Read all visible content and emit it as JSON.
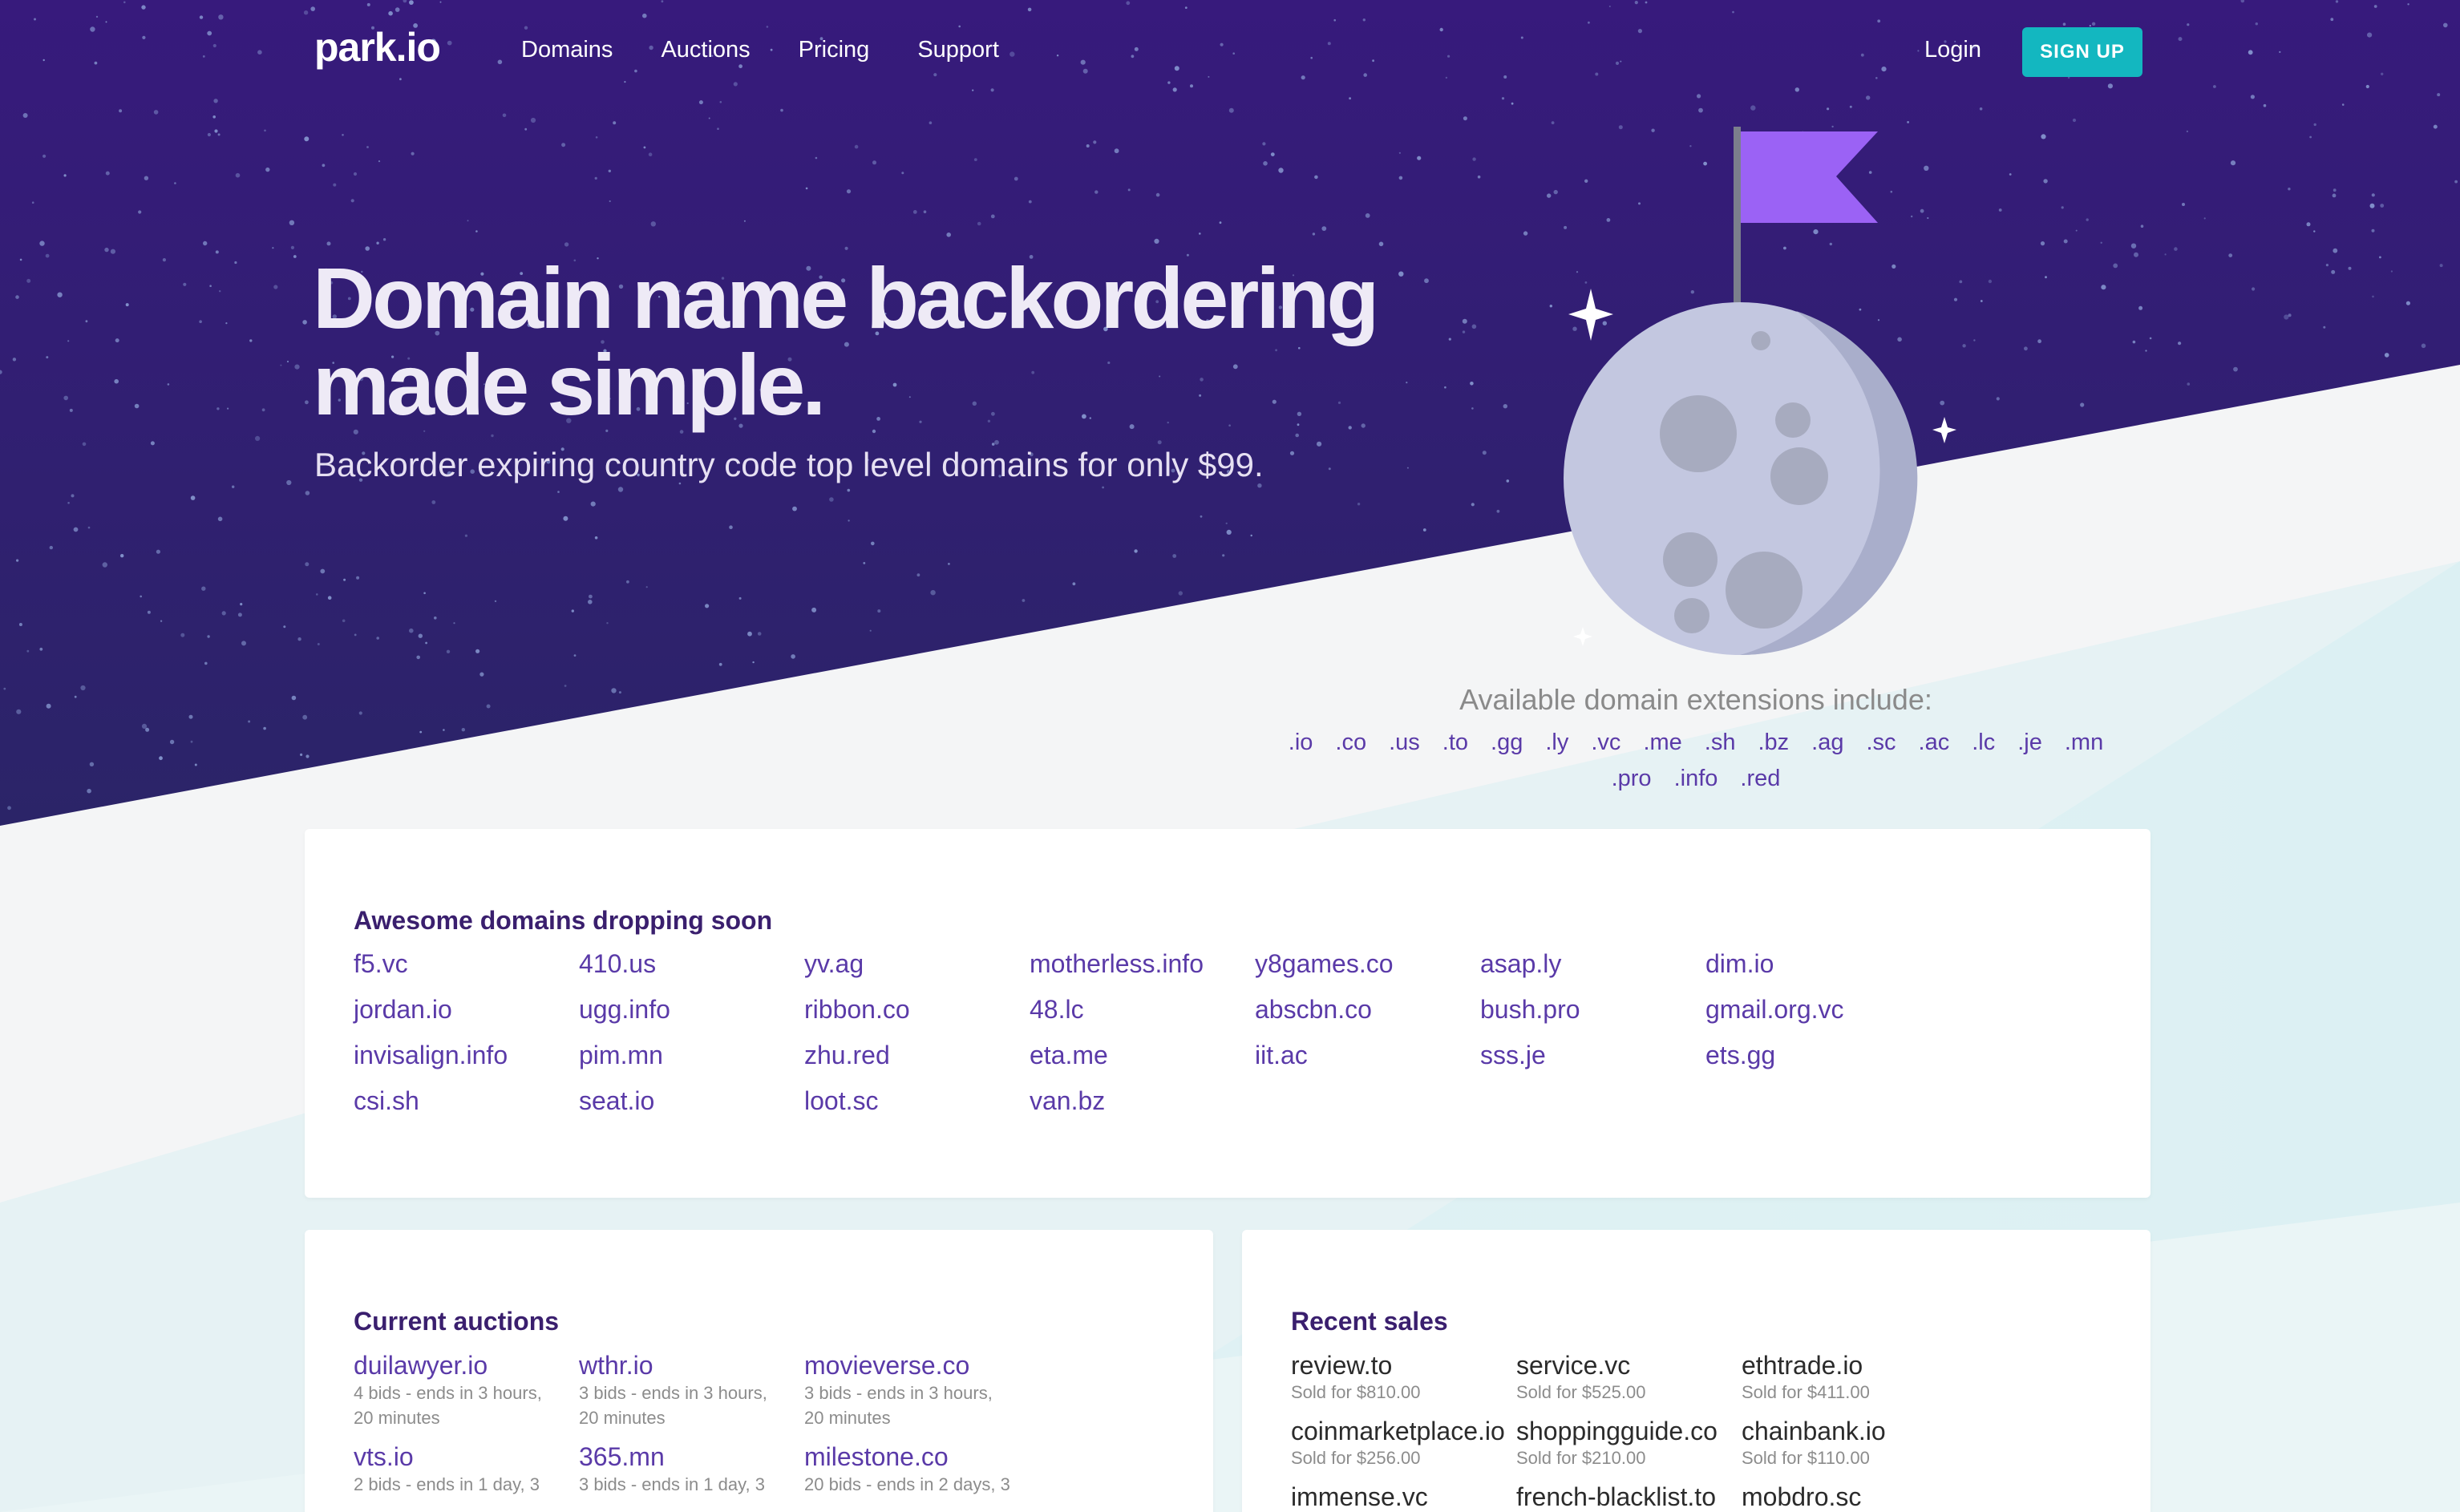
{
  "nav": {
    "logo": "park.io",
    "links": [
      "Domains",
      "Auctions",
      "Pricing",
      "Support"
    ],
    "login": "Login",
    "signup": "SIGN UP"
  },
  "hero": {
    "title_line1": "Domain name backordering",
    "title_line2": "made simple.",
    "subtitle": "Backorder expiring country code top level domains for only $99."
  },
  "extensions": {
    "title": "Available domain extensions include:",
    "items": [
      ".io",
      ".co",
      ".us",
      ".to",
      ".gg",
      ".ly",
      ".vc",
      ".me",
      ".sh",
      ".bz",
      ".ag",
      ".sc",
      ".ac",
      ".lc",
      ".je",
      ".mn",
      ".pro",
      ".info",
      ".red"
    ]
  },
  "dropping": {
    "title": "Awesome domains dropping soon",
    "domains": [
      "f5.vc",
      "410.us",
      "yv.ag",
      "motherless.info",
      "y8games.co",
      "asap.ly",
      "dim.io",
      "jordan.io",
      "ugg.info",
      "ribbon.co",
      "48.lc",
      "abscbn.co",
      "bush.pro",
      "gmail.org.vc",
      "invisalign.info",
      "pim.mn",
      "zhu.red",
      "eta.me",
      "iit.ac",
      "sss.je",
      "ets.gg",
      "csi.sh",
      "seat.io",
      "loot.sc",
      "van.bz"
    ]
  },
  "auctions": {
    "title": "Current auctions",
    "items": [
      {
        "name": "duilawyer.io",
        "meta": "4 bids - ends in 3 hours, 20 minutes"
      },
      {
        "name": "wthr.io",
        "meta": "3 bids - ends in 3 hours, 20 minutes"
      },
      {
        "name": "movieverse.co",
        "meta": "3 bids - ends in 3 hours, 20 minutes"
      },
      {
        "name": "vts.io",
        "meta": "2 bids - ends in 1 day, 3"
      },
      {
        "name": "365.mn",
        "meta": "3 bids - ends in 1 day, 3"
      },
      {
        "name": "milestone.co",
        "meta": "20 bids - ends in 2 days, 3"
      }
    ]
  },
  "sales": {
    "title": "Recent sales",
    "items": [
      {
        "name": "review.to",
        "meta": "Sold for $810.00"
      },
      {
        "name": "service.vc",
        "meta": "Sold for $525.00"
      },
      {
        "name": "ethtrade.io",
        "meta": "Sold for $411.00"
      },
      {
        "name": "coinmarketplace.io",
        "meta": "Sold for $256.00"
      },
      {
        "name": "shoppingguide.co",
        "meta": "Sold for $210.00"
      },
      {
        "name": "chainbank.io",
        "meta": "Sold for $110.00"
      },
      {
        "name": "immense.vc",
        "meta": ""
      },
      {
        "name": "french-blacklist.to",
        "meta": ""
      },
      {
        "name": "mobdro.sc",
        "meta": ""
      }
    ]
  },
  "colors": {
    "hero_top": "#371a7c",
    "hero_bottom": "#2a1f6b",
    "accent": "#13b7c0",
    "link": "#5a3aa8",
    "flag": "#9b62f5",
    "moon": "#c3c7e0"
  }
}
